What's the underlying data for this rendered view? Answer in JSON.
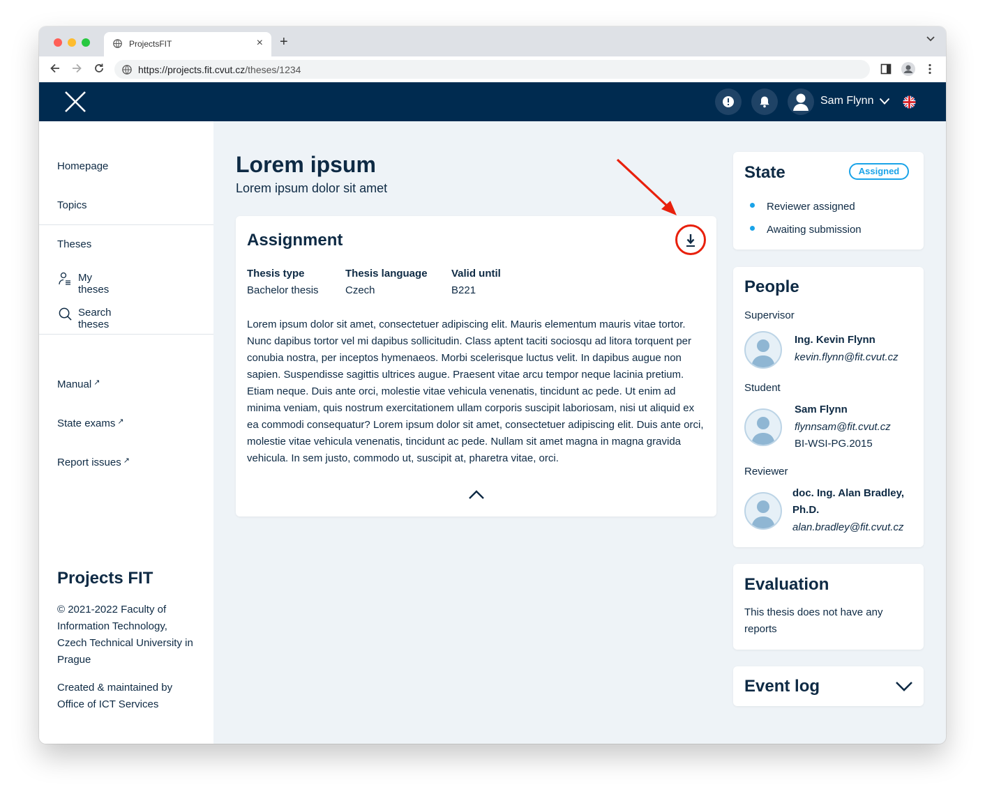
{
  "browser": {
    "tab_title": "ProjectsFIT",
    "url_host": "https://projects.fit.cvut.cz",
    "url_path": "/theses/1234",
    "colors": {
      "close": "#ff5f57",
      "minimize": "#febc2e",
      "zoom": "#28c840"
    }
  },
  "header": {
    "logo": "fit-x-logo",
    "user_name": "Sam Flynn",
    "icons": [
      "alert-icon",
      "bell-icon",
      "user-avatar-icon",
      "chevron-down-icon",
      "uk-flag-icon"
    ]
  },
  "sidebar": {
    "items": [
      {
        "label": "Homepage"
      },
      {
        "label": "Topics"
      },
      {
        "label": "Theses"
      },
      {
        "label": "My theses",
        "icon": "person-list-icon"
      },
      {
        "label": "Search theses",
        "icon": "search-icon"
      }
    ],
    "links": [
      {
        "label": "Manual",
        "icon": "external-link-icon"
      },
      {
        "label": "State exams",
        "icon": "external-link-icon"
      },
      {
        "label": "Report issues",
        "icon": "external-link-icon"
      }
    ],
    "footer": {
      "brand": "Projects FIT",
      "copyright": "© 2021-2022 Faculty of Information Technology, Czech Technical University in Prague",
      "maintained": "Created & maintained by Office of ICT Services"
    }
  },
  "main": {
    "title": "Lorem ipsum",
    "subtitle": "Lorem ipsum dolor sit amet",
    "assignment": {
      "heading": "Assignment",
      "meta": [
        {
          "label": "Thesis type",
          "value": "Bachelor thesis"
        },
        {
          "label": "Thesis language",
          "value": "Czech"
        },
        {
          "label": "Valid until",
          "value": "B221"
        }
      ],
      "text": "Lorem ipsum dolor sit amet, consectetuer adipiscing elit. Mauris elementum mauris vitae tortor. Nunc dapibus tortor vel mi dapibus sollicitudin. Class aptent taciti sociosqu ad litora torquent per conubia nostra, per inceptos hymenaeos. Morbi scelerisque luctus velit. In dapibus augue non sapien. Suspendisse sagittis ultrices augue. Praesent vitae arcu tempor neque lacinia pretium. Etiam neque. Duis ante orci, molestie vitae vehicula venenatis, tincidunt ac pede. Ut enim ad minima veniam, quis nostrum exercitationem ullam corporis suscipit laboriosam, nisi ut aliquid ex ea commodi consequatur? Lorem ipsum dolor sit amet, consectetuer adipiscing elit. Duis ante orci, molestie vitae vehicula venenatis, tincidunt ac pede. Nullam sit amet magna in magna gravida vehicula. In sem justo, commodo ut, suscipit at, pharetra vitae, orci.",
      "download_icon": "download-icon",
      "collapse_icon": "chevron-up-icon",
      "highlight_color": "#e8200c"
    }
  },
  "state": {
    "heading": "State",
    "badge": "Assigned",
    "items": [
      "Reviewer assigned",
      "Awaiting submission"
    ],
    "accent": "#1aa3e8"
  },
  "people": {
    "heading": "People",
    "supervisor": {
      "role": "Supervisor",
      "name": "Ing. Kevin Flynn",
      "email": "kevin.flynn@fit.cvut.cz"
    },
    "student": {
      "role": "Student",
      "name": "Sam Flynn",
      "email": "flynnsam@fit.cvut.cz",
      "code": "BI-WSI-PG.2015"
    },
    "reviewer": {
      "role": "Reviewer",
      "name_line1": "doc. Ing. Alan Bradley,",
      "name_line2": "Ph.D.",
      "email": "alan.bradley@fit.cvut.cz"
    }
  },
  "evaluation": {
    "heading": "Evaluation",
    "text": "This thesis does not have any reports"
  },
  "event_log": {
    "heading": "Event log"
  }
}
